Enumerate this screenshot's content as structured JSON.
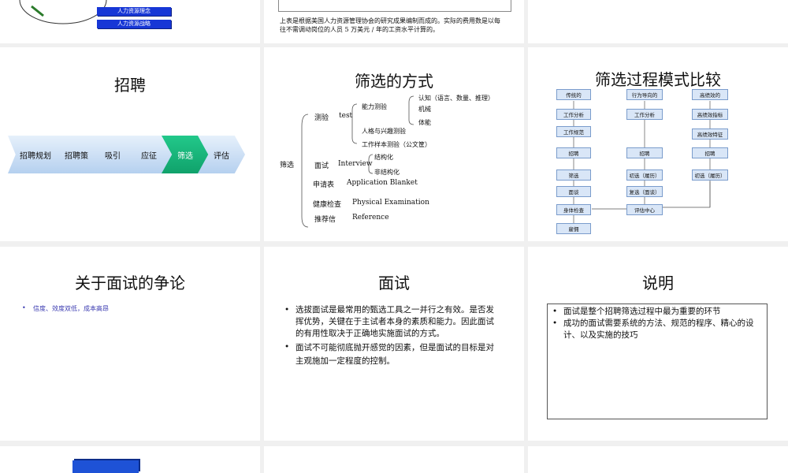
{
  "slide1": {
    "bars": [
      "人力资源理念",
      "人力资源战略"
    ]
  },
  "slide2": {
    "note1": "上表是根据美国人力资源管理协会的研究成果编制而成的。实际的费用数是以每",
    "note2": "往不需调动岗位的人员 5 万美元 / 年的工资水平计算的。"
  },
  "recruit": {
    "title": "招聘",
    "steps": [
      "招聘规划",
      "招聘策",
      "吸引",
      "应征",
      "筛选",
      "评估"
    ]
  },
  "methods": {
    "title": "筛选的方式",
    "root": "筛选",
    "test_cn": "测验",
    "test_en": "test",
    "ability": "能力测验",
    "cognitive": "认知（语言、数量、推理）",
    "mechanical": "机械",
    "physical": "体能",
    "personality": "人格与兴趣测验",
    "work_sample": "工作样本测验（公文筐）",
    "interview_cn": "面试",
    "interview_en": "Interview",
    "structured": "结构化",
    "unstructured": "非结构化",
    "app_cn": "申请表",
    "app_en": "Application Blanket",
    "health_cn": "健康检查",
    "health_en": "Physical Examination",
    "ref_cn": "推荐信",
    "ref_en": "Reference"
  },
  "process": {
    "title": "筛选过程模式比较",
    "col1": [
      "传统的",
      "工作分析",
      "工作规范",
      "招聘",
      "筛选",
      "面谈",
      "身体检查",
      "雇佣"
    ],
    "col2": [
      "行为导向的",
      "工作分析",
      "招聘",
      "初选（履历）",
      "复选（面谈）",
      "评估中心"
    ],
    "col3": [
      "高绩效的",
      "高绩效指标",
      "高绩效特征",
      "招聘",
      "初选（履历）"
    ]
  },
  "debate": {
    "title": "关于面试的争论",
    "bullet": "信度、效度双低，成本高昂"
  },
  "interview": {
    "title": "面试",
    "b1": "选拔面试是最常用的甄选工具之一并行之有效。是否发挥优势，关键在于主试者本身的素质和能力。因此面试的有用性取决于正确地实施面试的方式。",
    "b2": "面试不可能彻底抛开感觉的因素，但是面试的目标是对主观施加一定程度的控制。"
  },
  "explain": {
    "title": "说明",
    "b1": "面试是整个招聘筛选过程中最为重要的环节",
    "b2": "成功的面试需要系统的方法、规范的程序、精心的设计、以及实施的技巧"
  }
}
